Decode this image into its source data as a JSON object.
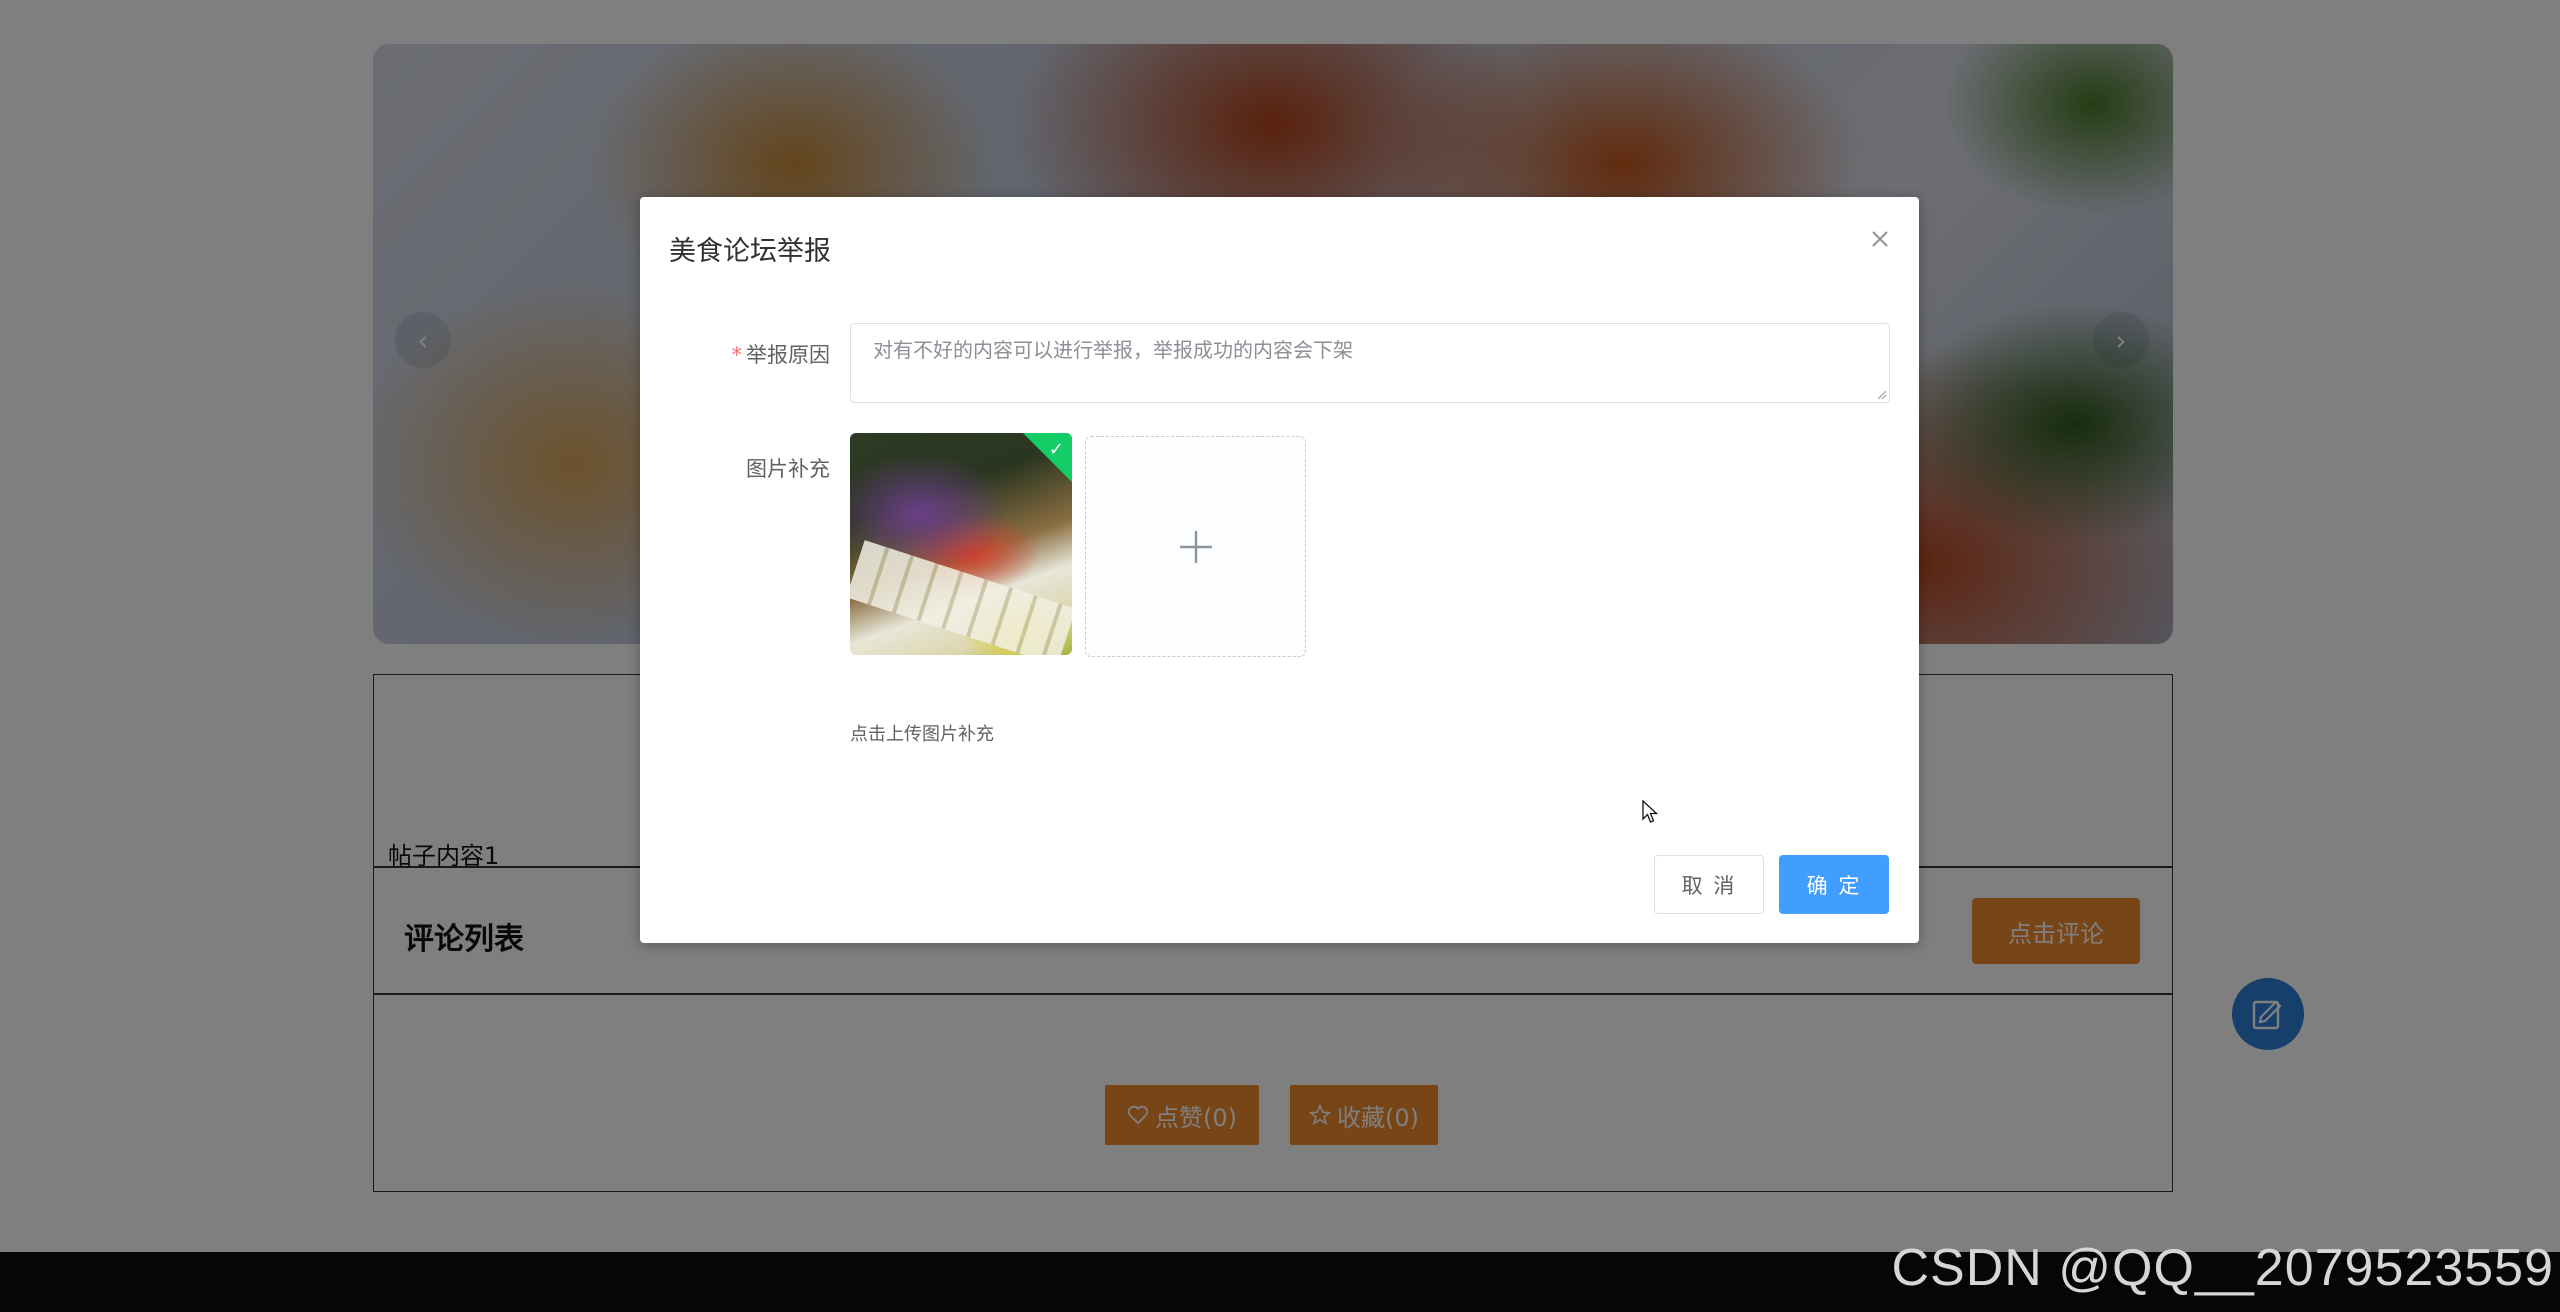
{
  "page": {
    "post_content": "帖子内容1",
    "comment_list_title": "评论列表",
    "comment_button": "点击评论",
    "like_button": "点赞(0)",
    "favorite_button": "收藏(0)",
    "carousel_prev": "‹",
    "carousel_next": "›"
  },
  "dialog": {
    "title": "美食论坛举报",
    "reason_label": "举报原因",
    "required_mark": "*",
    "reason_placeholder": "对有不好的内容可以进行举报，举报成功的内容会下架",
    "reason_value": "",
    "image_label": "图片补充",
    "upload_tip": "点击上传图片补充",
    "cancel_button": "取 消",
    "confirm_button": "确 定"
  },
  "watermark": "CSDN @QQ__2079523559",
  "colors": {
    "primary": "#409eff",
    "orange": "#f08a2c",
    "float_button": "#2f7fd6",
    "success": "#13ce66",
    "required": "#f56c6c"
  },
  "icons": {
    "close": "close-icon",
    "plus": "plus-icon",
    "heart": "heart-icon",
    "star": "star-icon",
    "edit": "edit-icon",
    "check": "check-icon"
  }
}
